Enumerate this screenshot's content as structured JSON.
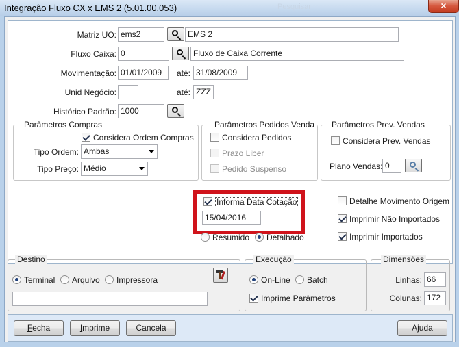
{
  "window": {
    "title": "Integração Fluxo CX x EMS 2 (5.01.00.053)",
    "background_title": "Pesquisar",
    "close_glyph": "×"
  },
  "form": {
    "matriz_uo": {
      "label": "Matriz UO:",
      "code": "ems2",
      "desc": "EMS 2"
    },
    "fluxo_caixa": {
      "label": "Fluxo Caixa:",
      "code": "0",
      "desc": "Fluxo de Caixa Corrente"
    },
    "movimentacao": {
      "label": "Movimentação:",
      "from": "01/01/2009",
      "ate_label": "até:",
      "to": "31/08/2009"
    },
    "unid_negocio": {
      "label": "Unid Negócio:",
      "from": "",
      "ate_label": "até:",
      "to": "ZZZ"
    },
    "historico_padrao": {
      "label": "Histórico Padrão:",
      "value": "1000"
    }
  },
  "parametros_compras": {
    "title": "Parâmetros Compras",
    "considera_ordem": {
      "label": "Considera Ordem Compras",
      "checked": true
    },
    "tipo_ordem": {
      "label": "Tipo Ordem:",
      "value": "Ambas"
    },
    "tipo_preco": {
      "label": "Tipo Preço:",
      "value": "Médio"
    }
  },
  "parametros_pedidos_venda": {
    "title": "Parâmetros Pedidos Venda",
    "considera_pedidos": {
      "label": "Considera Pedidos",
      "checked": false
    },
    "prazo_liber": {
      "label": "Prazo Liber",
      "checked": false
    },
    "pedido_suspenso": {
      "label": "Pedido Suspenso",
      "checked": false
    }
  },
  "parametros_prev_vendas": {
    "title": "Parâmetros Prev. Vendas",
    "considera_prev": {
      "label": "Considera Prev. Vendas",
      "checked": false
    },
    "plano_vendas": {
      "label": "Plano Vendas:",
      "value": "0"
    }
  },
  "cotacao": {
    "informa_data": {
      "label": "Informa Data Cotação",
      "checked": true
    },
    "data": "15/04/2016",
    "resumido": "Resumido",
    "detalhado": "Detalhado",
    "highlight_color": "#d0131b"
  },
  "options_right": {
    "detalhe_movimento": {
      "label": "Detalhe Movimento Origem",
      "checked": false
    },
    "imprimir_nao_importados": {
      "label": "Imprimir Não Importados",
      "checked": true
    },
    "imprimir_importados": {
      "label": "Imprimir Importados",
      "checked": true
    }
  },
  "destino": {
    "title": "Destino",
    "terminal": "Terminal",
    "arquivo": "Arquivo",
    "impressora": "Impressora",
    "path": ""
  },
  "execucao": {
    "title": "Execução",
    "online": "On-Line",
    "batch": "Batch",
    "imprime_parametros": {
      "label": "Imprime Parâmetros",
      "checked": true
    }
  },
  "dimensoes": {
    "title": "Dimensões",
    "linhas": {
      "label": "Linhas:",
      "value": "66"
    },
    "colunas": {
      "label": "Colunas:",
      "value": "172"
    }
  },
  "buttons": {
    "fecha": {
      "first": "F",
      "rest": "echa"
    },
    "imprime": {
      "first": "I",
      "rest": "mprime"
    },
    "cancela": "Cancela",
    "ajuda": "Ajuda"
  }
}
